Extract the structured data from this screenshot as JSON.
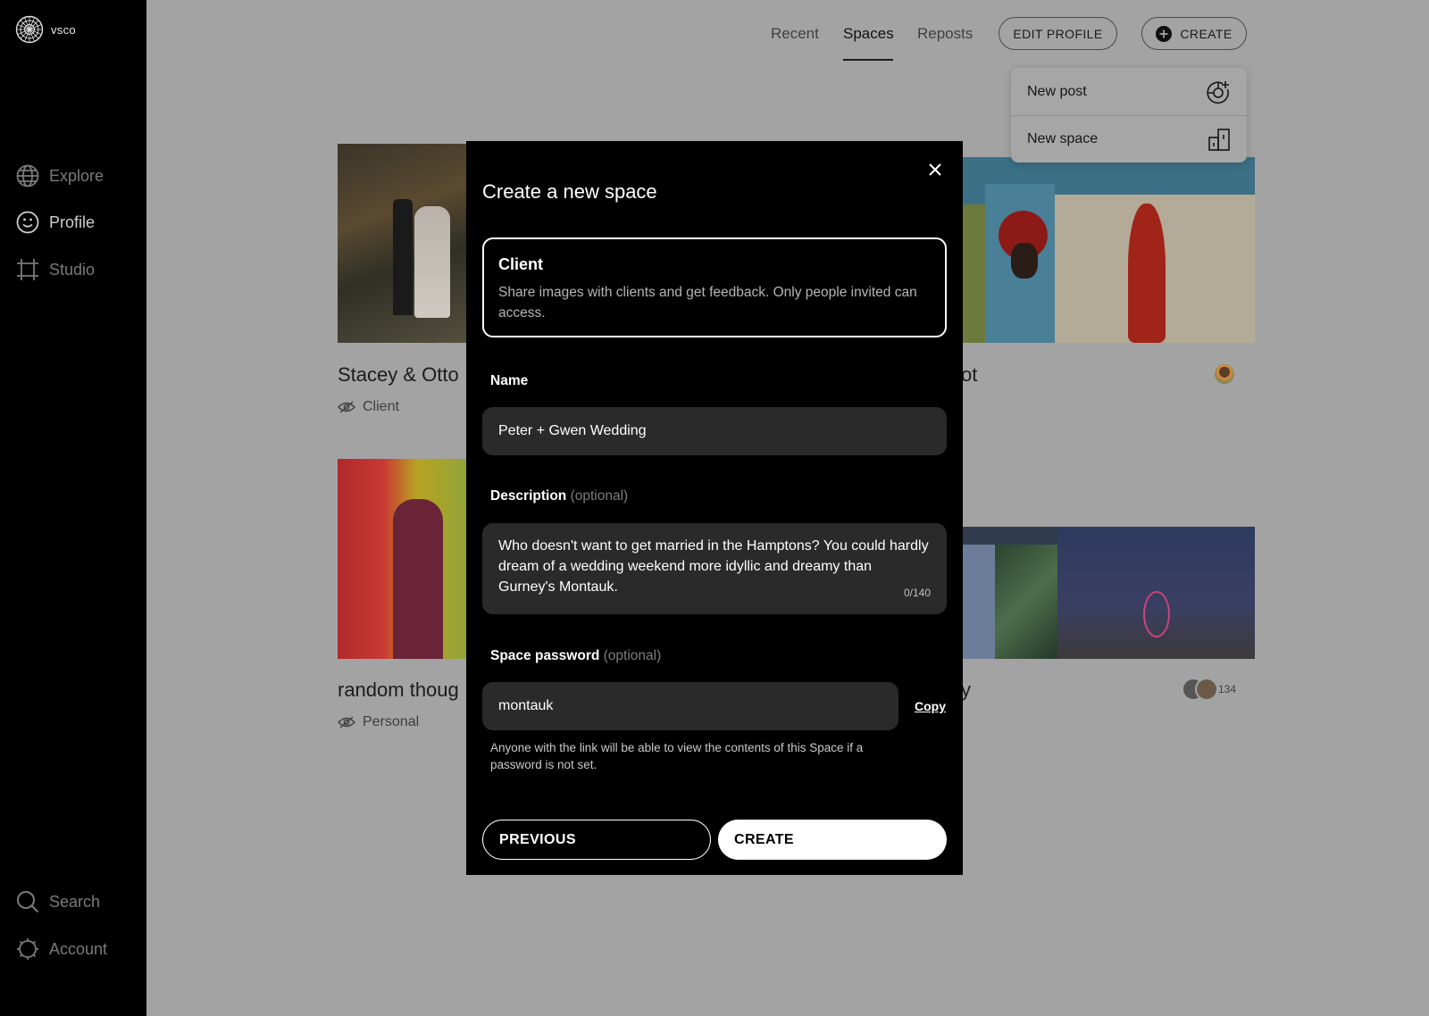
{
  "brand": {
    "name": "vsco"
  },
  "sidebar": {
    "items": [
      {
        "label": "Explore",
        "icon": "globe-icon"
      },
      {
        "label": "Profile",
        "icon": "smiley-icon"
      },
      {
        "label": "Studio",
        "icon": "crop-icon"
      }
    ],
    "bottom": [
      {
        "label": "Search",
        "icon": "search-icon"
      },
      {
        "label": "Account",
        "icon": "gear-icon"
      }
    ]
  },
  "header": {
    "tabs": [
      {
        "label": "Recent"
      },
      {
        "label": "Spaces",
        "active": true
      },
      {
        "label": "Reposts"
      }
    ],
    "edit_profile": "EDIT PROFILE",
    "create": "CREATE"
  },
  "create_menu": {
    "items": [
      {
        "label": "New post",
        "icon": "new-post-icon"
      },
      {
        "label": "New space",
        "icon": "new-space-icon"
      }
    ]
  },
  "spaces": [
    {
      "title": "Stacey & Otto",
      "meta": "Client"
    },
    {
      "title": "ot",
      "meta": ""
    },
    {
      "title": "random thoug",
      "meta": "Personal"
    },
    {
      "title": "y",
      "meta": "",
      "count": "134"
    }
  ],
  "modal": {
    "title": "Create a new space",
    "type_title": "Client",
    "type_desc": "Share images with clients and get feedback. Only people invited can access.",
    "name_label": "Name",
    "name_value": "Peter + Gwen Wedding",
    "description_label": "Description",
    "optional": "(optional)",
    "description_value": "Who doesn't want to get married in the Hamptons? You could hardly dream of a wedding weekend more idyllic and dreamy than Gurney's Montauk.",
    "description_counter": "0/140",
    "password_label": "Space password",
    "password_value": "montauk",
    "copy_label": "Copy",
    "hint": "Anyone with the link will be able to view the contents of this Space if a password is not set.",
    "previous_label": "PREVIOUS",
    "create_label": "CREATE"
  },
  "colors": {
    "overlay_bg": "#a3a3a3",
    "sidebar_bg": "#000000",
    "modal_bg": "#000000",
    "input_bg": "#2a2a2a"
  }
}
